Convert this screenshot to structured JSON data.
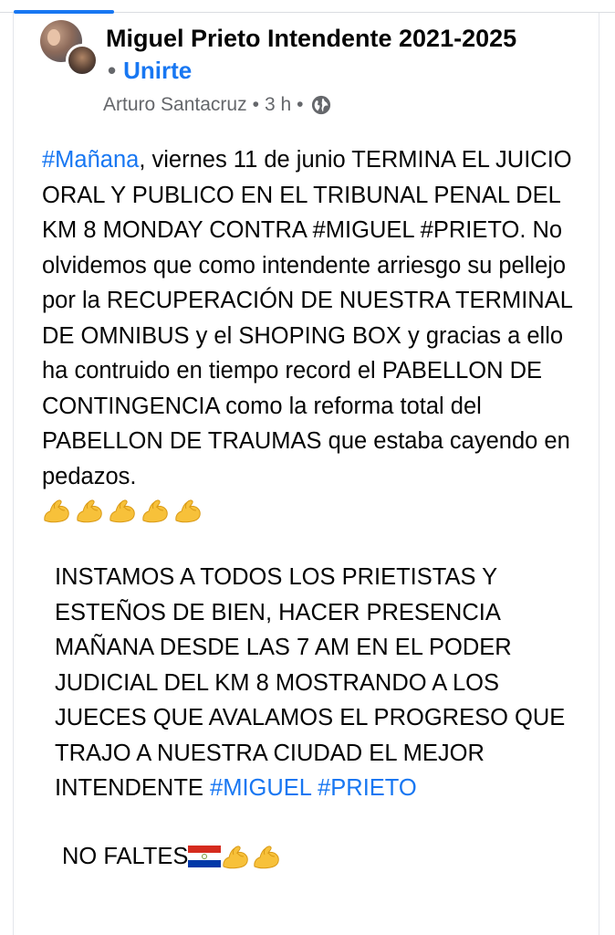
{
  "post": {
    "group_name": "Miguel Prieto Intendente 2021-2025",
    "join_dot": "•",
    "join_label": "Unirte",
    "author": "Arturo Santacruz",
    "meta_sep": "•",
    "time": "3 h",
    "privacy_icon": "globe-icon"
  },
  "body": {
    "p1_hashtag": "#Mañana",
    "p1_text": ", viernes 11 de junio TERMINA EL JUICIO ORAL Y PUBLICO EN EL TRIBUNAL PENAL DEL KM 8 MONDAY CONTRA #MIGUEL #PRIETO. No olvidemos que como intendente  arriesgo su pellejo por la RECUPERACIÓN DE NUESTRA TERMINAL DE OMNIBUS y el SHOPING BOX y gracias a ello ha contruido en tiempo record el PABELLON DE CONTINGENCIA como la reforma total del PABELLON DE TRAUMAS que estaba cayendo en pedazos.",
    "flex_emoji_count": 5,
    "p2_text": "INSTAMOS A TODOS LOS PRIETISTAS Y ESTEÑOS DE BIEN, HACER PRESENCIA MAÑANA DESDE LAS 7 AM EN EL PODER JUDICIAL DEL KM 8 MOSTRANDO A LOS JUECES QUE AVALAMOS EL PROGRESO QUE TRAJO A NUESTRA CIUDAD EL MEJOR INTENDENTE ",
    "p2_hashtags": "#MIGUEL #PRIETO",
    "p3_text": "NO FALTES",
    "p3_icons": [
      "paraguay-flag-icon",
      "flexed-biceps-icon",
      "flexed-biceps-icon"
    ]
  },
  "colors": {
    "link": "#1877f2",
    "text": "#050505",
    "secondary": "#65676b"
  }
}
